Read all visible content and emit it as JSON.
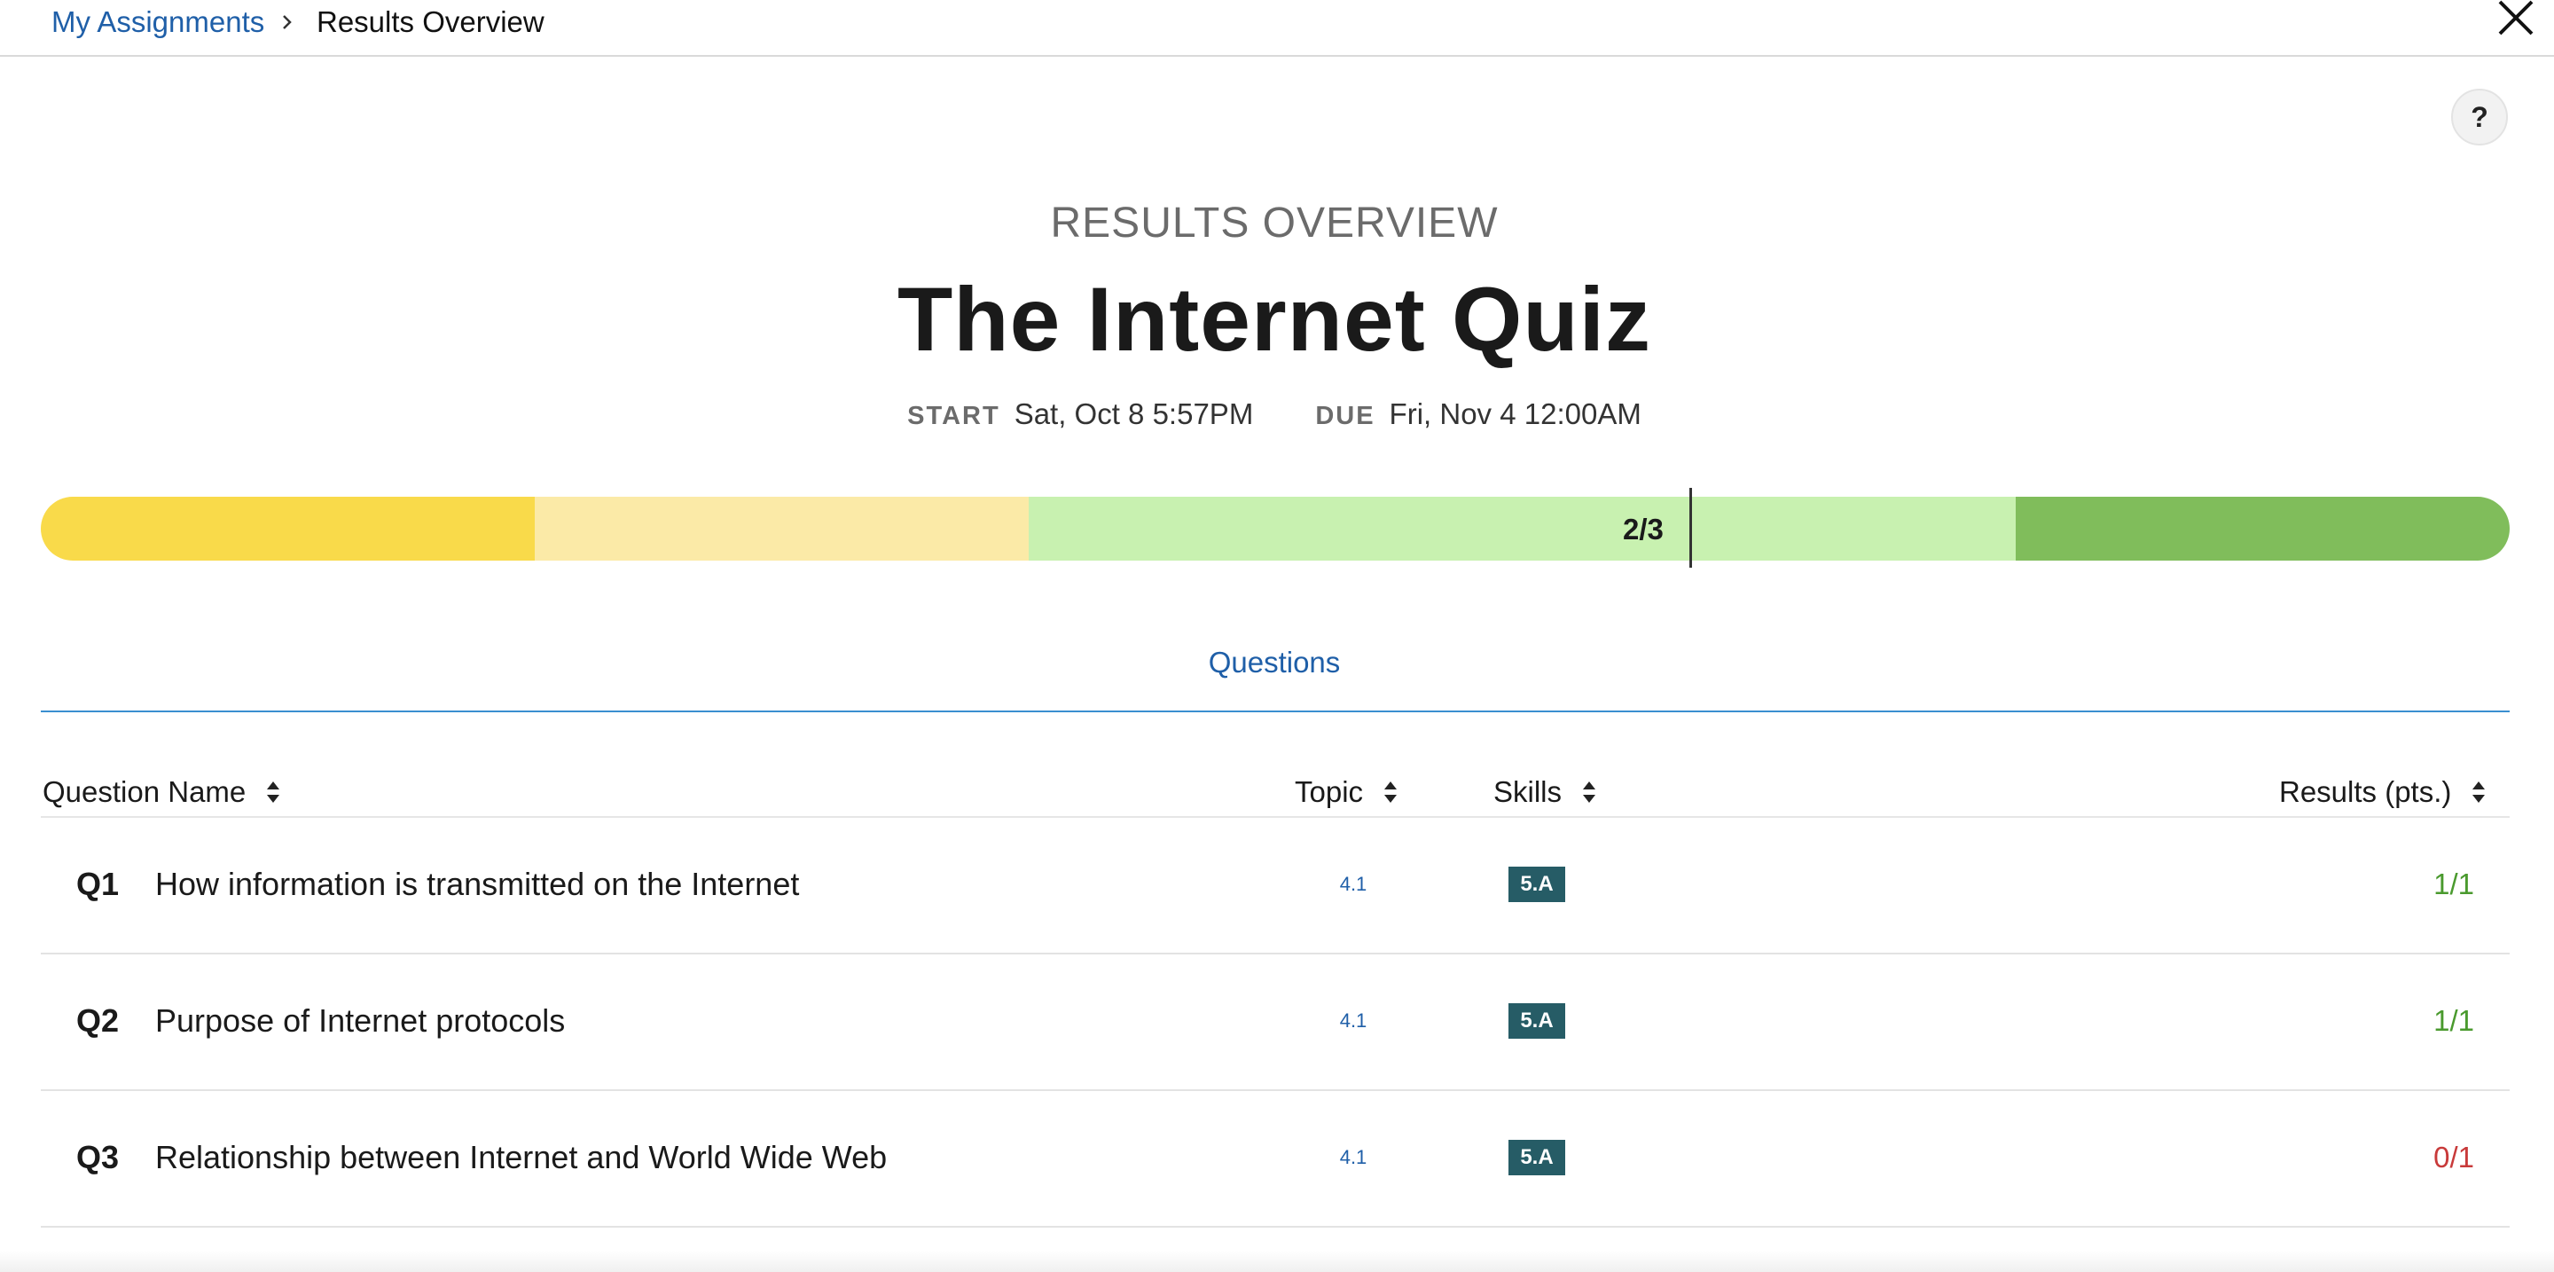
{
  "breadcrumb": {
    "parent": "My Assignments",
    "current": "Results Overview"
  },
  "help": {
    "label": "?"
  },
  "header": {
    "overline": "RESULTS OVERVIEW",
    "title": "The Internet Quiz",
    "start_label": "START",
    "start_value": "Sat, Oct 8 5:57PM",
    "due_label": "DUE",
    "due_value": "Fri, Nov 4 12:00AM"
  },
  "progress": {
    "score_label": "2/3",
    "score_fraction": 0.667,
    "colors": [
      "#f9da4a",
      "#fbeaa7",
      "#c8f1b0",
      "#c8f1b0",
      "#80bd5b"
    ]
  },
  "tabs": [
    {
      "label": "Questions",
      "active": true
    }
  ],
  "table": {
    "columns": {
      "name": "Question Name",
      "topic": "Topic",
      "skills": "Skills",
      "results": "Results (pts.)"
    },
    "rows": [
      {
        "num": "Q1",
        "name": "How information is transmitted on the Internet",
        "topic": "4.1",
        "skill": "5.A",
        "result": "1/1",
        "status": "correct"
      },
      {
        "num": "Q2",
        "name": "Purpose of Internet protocols",
        "topic": "4.1",
        "skill": "5.A",
        "result": "1/1",
        "status": "correct"
      },
      {
        "num": "Q3",
        "name": "Relationship between Internet and World Wide Web",
        "topic": "4.1",
        "skill": "5.A",
        "result": "0/1",
        "status": "incorrect"
      }
    ]
  },
  "colors": {
    "link": "#1f5fa8",
    "correct": "#4a9a2e",
    "incorrect": "#c83a3a",
    "skill_badge": "#265c66"
  }
}
